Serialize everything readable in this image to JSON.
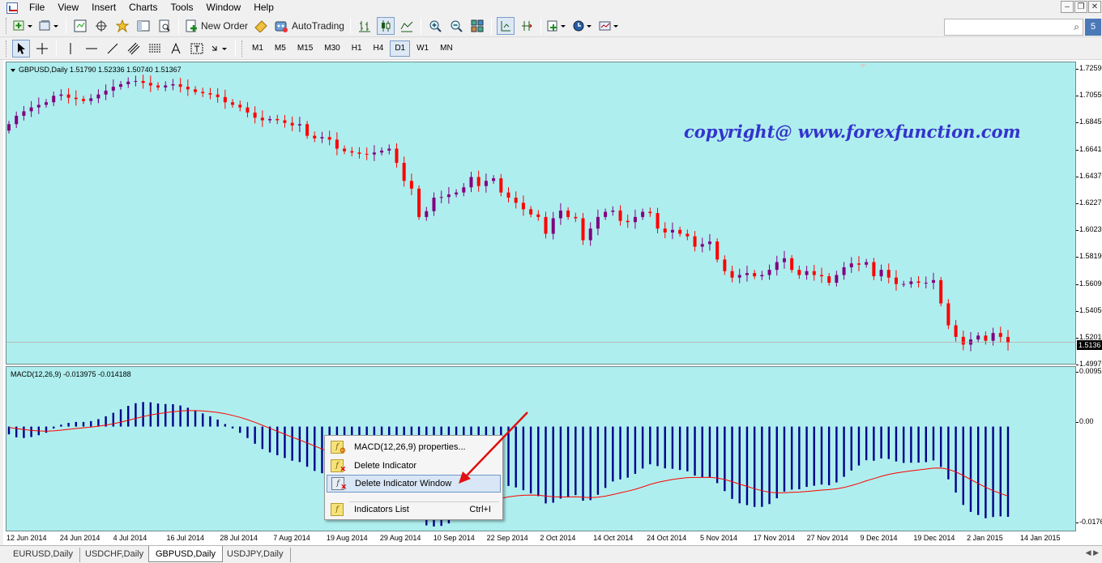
{
  "menu": [
    "File",
    "View",
    "Insert",
    "Charts",
    "Tools",
    "Window",
    "Help"
  ],
  "toolbar1": {
    "new_order": "New Order",
    "autotrading": "AutoTrading"
  },
  "timeframes": [
    "M1",
    "M5",
    "M15",
    "M30",
    "H1",
    "H4",
    "D1",
    "W1",
    "MN"
  ],
  "active_timeframe": "D1",
  "search": {
    "value": ""
  },
  "price_chart": {
    "title": "GBPUSD,Daily  1.51790 1.52336 1.50740 1.51367",
    "copyright": "copyright@ www.forexfunction.com",
    "axis_labels": [
      "1.72590",
      "1.70550",
      "1.68450",
      "1.66410",
      "1.64370",
      "1.62270",
      "1.60230",
      "1.58190",
      "1.56090",
      "1.54050",
      "1.52010",
      "1.49970"
    ],
    "current_price": "1.5136",
    "colors": {
      "up": "#800080",
      "down": "#ff0000",
      "background": "#afeeee"
    }
  },
  "macd": {
    "title": "MACD(12,26,9) -0.013975 -0.014188",
    "axis_labels": [
      "0.00956",
      "0.00",
      "-0.0176"
    ],
    "colors": {
      "histogram": "#00008b",
      "signal": "#ff0000"
    }
  },
  "time_axis": [
    "12 Jun 2014",
    "24 Jun 2014",
    "4 Jul 2014",
    "16 Jul 2014",
    "28 Jul 2014",
    "7 Aug 2014",
    "19 Aug 2014",
    "29 Aug 2014",
    "10 Sep 2014",
    "22 Sep 2014",
    "2 Oct 2014",
    "14 Oct 2014",
    "24 Oct 2014",
    "5 Nov 2014",
    "17 Nov 2014",
    "27 Nov 2014",
    "9 Dec 2014",
    "19 Dec 2014",
    "2 Jan 2015",
    "14 Jan 2015"
  ],
  "tabs": [
    {
      "label": "EURUSD,Daily",
      "active": false
    },
    {
      "label": "USDCHF,Daily",
      "active": false
    },
    {
      "label": "GBPUSD,Daily",
      "active": true
    },
    {
      "label": "USDJPY,Daily",
      "active": false
    }
  ],
  "context_menu": {
    "items": [
      {
        "label": "MACD(12,26,9) properties...",
        "icon": "indicator-properties-icon",
        "shortcut": ""
      },
      {
        "label": "Delete Indicator",
        "icon": "delete-indicator-icon",
        "shortcut": ""
      },
      {
        "label": "Delete Indicator Window",
        "icon": "delete-window-icon",
        "shortcut": "",
        "highlighted": true
      },
      {
        "label": "Indicators List",
        "icon": "indicators-list-icon",
        "shortcut": "Ctrl+I"
      }
    ]
  },
  "chart_data": [
    {
      "type": "candlestick",
      "title": "GBPUSD,Daily",
      "ohlc_last": {
        "open": 1.5179,
        "high": 1.52336,
        "low": 1.5074,
        "close": 1.51367
      },
      "x_range": [
        "2014-06-12",
        "2015-01-16"
      ],
      "ylim": [
        1.4997,
        1.7259
      ],
      "close_series": [
        1.683,
        1.6895,
        1.693,
        1.696,
        1.698,
        1.7,
        1.705,
        1.706,
        1.7035,
        1.7025,
        1.701,
        1.703,
        1.706,
        1.709,
        1.712,
        1.714,
        1.716,
        1.7165,
        1.715,
        1.713,
        1.7115,
        1.713,
        1.714,
        1.712,
        1.71,
        1.708,
        1.707,
        1.706,
        1.704,
        1.7,
        1.698,
        1.696,
        1.692,
        1.688,
        1.686,
        1.687,
        1.686,
        1.684,
        1.682,
        1.683,
        1.674,
        1.672,
        1.673,
        1.671,
        1.664,
        1.662,
        1.661,
        1.66,
        1.6595,
        1.661,
        1.6625,
        1.664,
        1.653,
        1.639,
        1.633,
        1.611,
        1.6155,
        1.626,
        1.6265,
        1.6285,
        1.63,
        1.634,
        1.642,
        1.635,
        1.639,
        1.641,
        1.63,
        1.626,
        1.622,
        1.617,
        1.613,
        1.611,
        1.598,
        1.61,
        1.616,
        1.611,
        1.61,
        1.593,
        1.602,
        1.611,
        1.615,
        1.616,
        1.608,
        1.607,
        1.611,
        1.615,
        1.614,
        1.602,
        1.599,
        1.601,
        1.598,
        1.596,
        1.588,
        1.59,
        1.592,
        1.578,
        1.569,
        1.564,
        1.566,
        1.5675,
        1.565,
        1.566,
        1.57,
        1.576,
        1.579,
        1.57,
        1.566,
        1.569,
        1.566,
        1.565,
        1.56,
        1.566,
        1.572,
        1.575,
        1.574,
        1.576,
        1.565,
        1.57,
        1.564,
        1.559,
        1.559,
        1.561,
        1.56,
        1.56,
        1.562,
        1.544,
        1.527,
        1.518,
        1.512,
        1.516,
        1.519,
        1.515,
        1.521,
        1.518,
        1.5137
      ]
    },
    {
      "type": "bar",
      "title": "MACD(12,26,9)",
      "series": [
        {
          "name": "MACD(12,26,9)",
          "last": -0.013975
        },
        {
          "name": "Signal",
          "last": -0.014188
        }
      ],
      "ylim": [
        -0.0176,
        0.00956
      ]
    }
  ]
}
